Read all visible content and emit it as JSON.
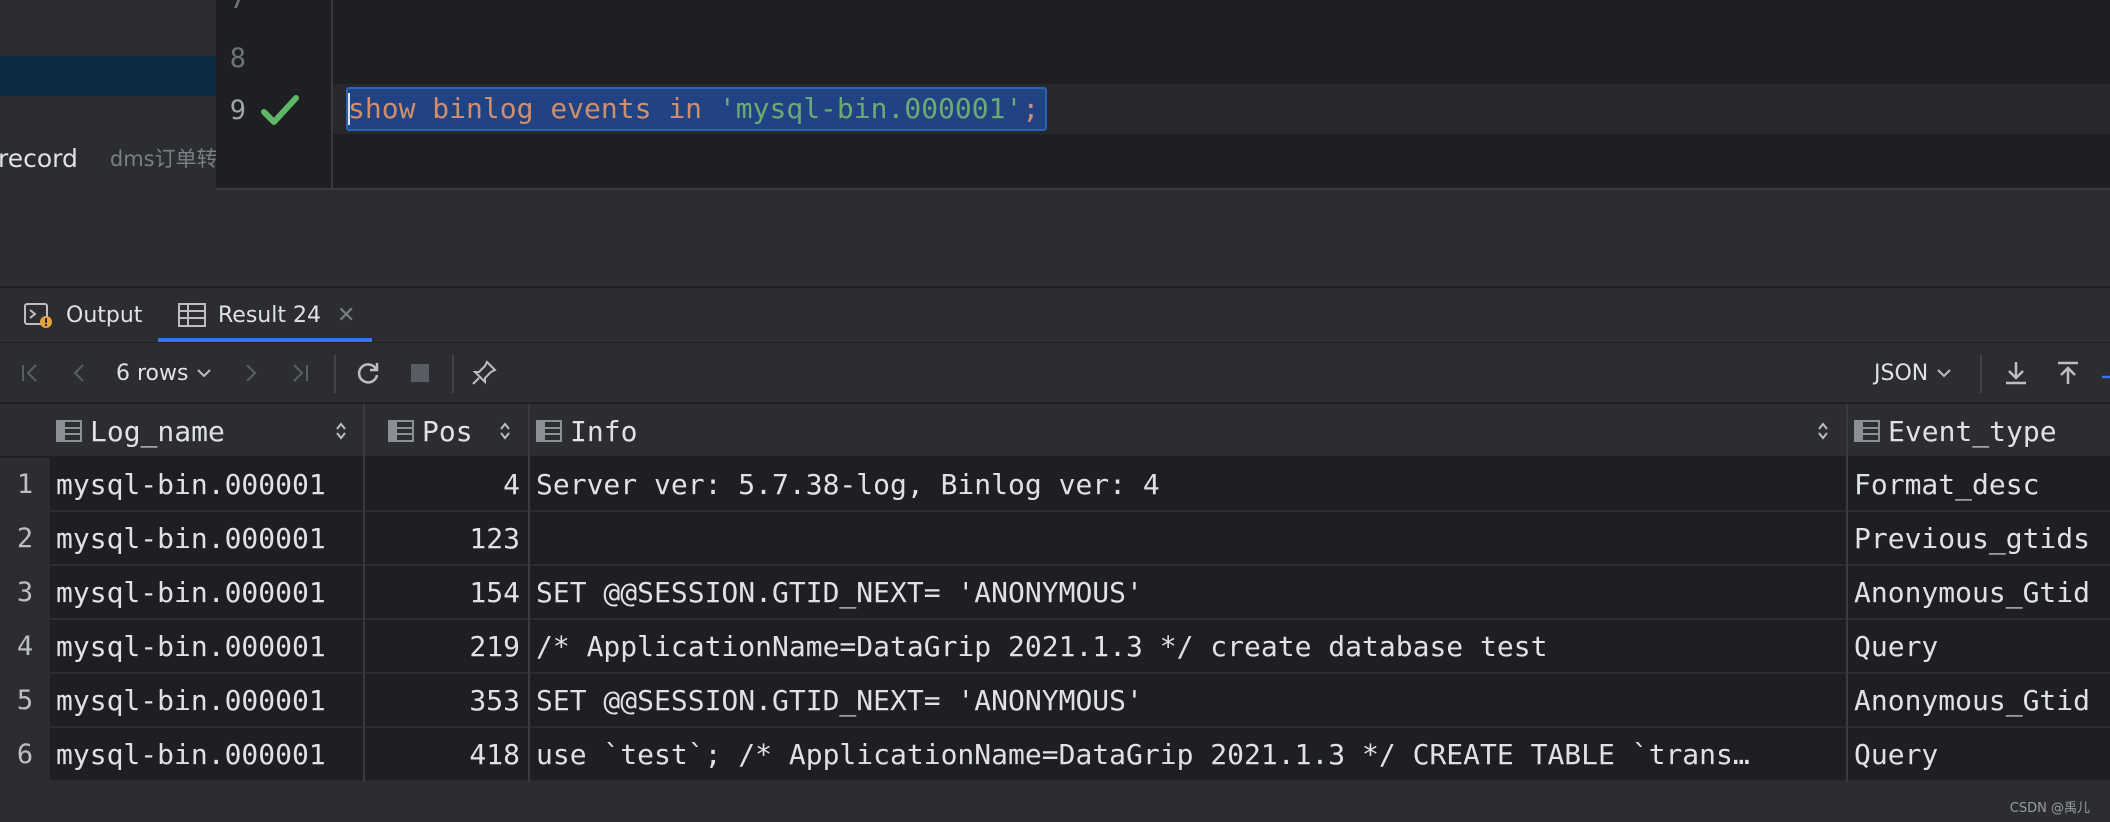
{
  "left_panel": {
    "item_label": "record",
    "item_sub": "dms订单转"
  },
  "editor": {
    "line_numbers": [
      "7",
      "8",
      "9"
    ],
    "code": {
      "kw1": "show",
      "kw2": "binlog",
      "kw3": "events",
      "kw4": "in",
      "string": "'mysql-bin.000001'",
      "terminator": ";"
    }
  },
  "tabs": {
    "output_label": "Output",
    "result_label": "Result 24"
  },
  "toolbar": {
    "rows_label": "6 rows",
    "format_label": "JSON"
  },
  "grid": {
    "columns": [
      "Log_name",
      "Pos",
      "Info",
      "Event_type"
    ],
    "rows": [
      {
        "n": "1",
        "log": "mysql-bin.000001",
        "pos": "4",
        "info": "Server ver: 5.7.38-log, Binlog ver: 4",
        "evt": "Format_desc"
      },
      {
        "n": "2",
        "log": "mysql-bin.000001",
        "pos": "123",
        "info": "",
        "evt": "Previous_gtids"
      },
      {
        "n": "3",
        "log": "mysql-bin.000001",
        "pos": "154",
        "info": "SET @@SESSION.GTID_NEXT= 'ANONYMOUS'",
        "evt": "Anonymous_Gtid"
      },
      {
        "n": "4",
        "log": "mysql-bin.000001",
        "pos": "219",
        "info": "/* ApplicationName=DataGrip 2021.1.3 */ create database test",
        "evt": "Query"
      },
      {
        "n": "5",
        "log": "mysql-bin.000001",
        "pos": "353",
        "info": "SET @@SESSION.GTID_NEXT= 'ANONYMOUS'",
        "evt": "Anonymous_Gtid"
      },
      {
        "n": "6",
        "log": "mysql-bin.000001",
        "pos": "418",
        "info": "use `test`; /* ApplicationName=DataGrip 2021.1.3 */ CREATE TABLE `trans…",
        "evt": "Query"
      }
    ]
  },
  "watermark": "CSDN @禹儿"
}
